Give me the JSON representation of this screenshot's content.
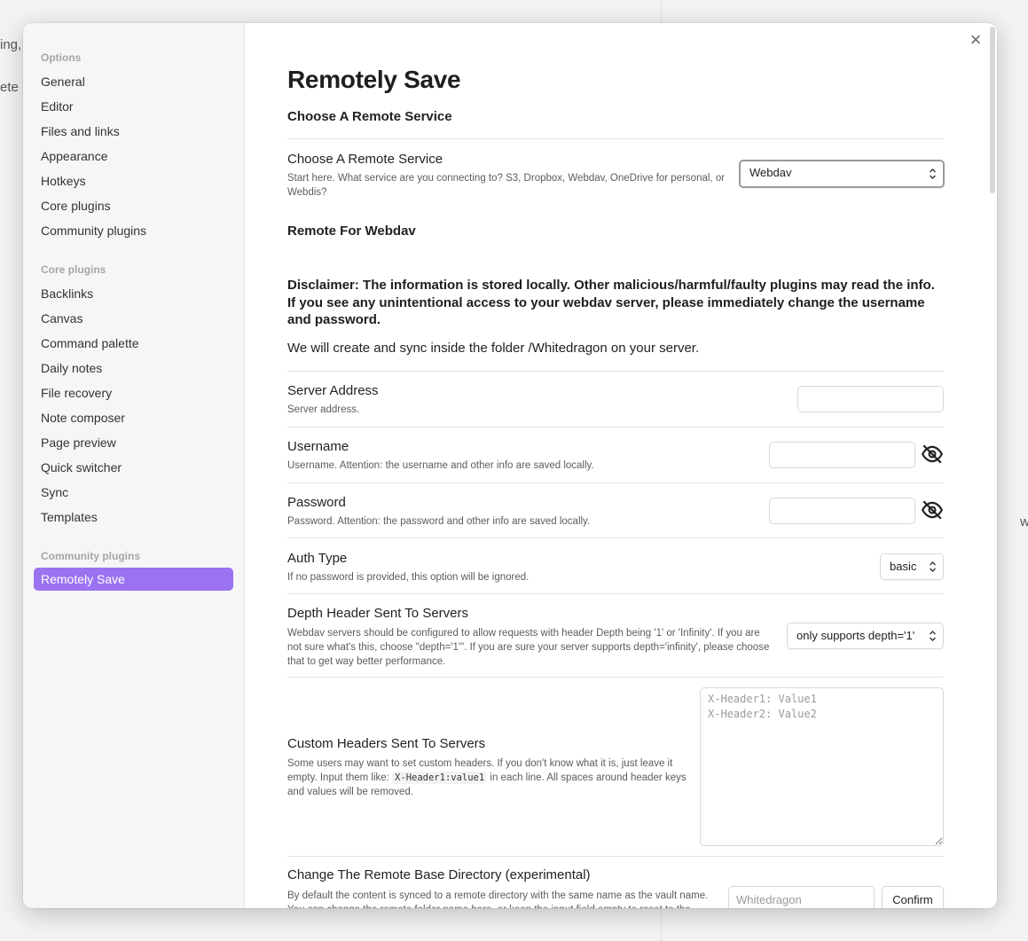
{
  "background": {
    "frag1": "ing,",
    "frag2": "ete",
    "frag3": "w"
  },
  "sidebar": {
    "groups": [
      {
        "heading": "Options",
        "items": [
          "General",
          "Editor",
          "Files and links",
          "Appearance",
          "Hotkeys",
          "Core plugins",
          "Community plugins"
        ]
      },
      {
        "heading": "Core plugins",
        "items": [
          "Backlinks",
          "Canvas",
          "Command palette",
          "Daily notes",
          "File recovery",
          "Note composer",
          "Page preview",
          "Quick switcher",
          "Sync",
          "Templates"
        ]
      },
      {
        "heading": "Community plugins",
        "items": [
          "Remotely Save"
        ]
      }
    ],
    "active_item": "Remotely Save"
  },
  "content": {
    "close_symbol": "×",
    "title": "Remotely Save",
    "section_choose": "Choose A Remote Service",
    "service": {
      "name": "Choose A Remote Service",
      "desc": "Start here. What service are you connecting to? S3, Dropbox, Webdav, OneDrive for personal, or Webdis?",
      "value": "Webdav"
    },
    "section_webdav": "Remote For Webdav",
    "disclaimer": "Disclaimer: The information is stored locally. Other malicious/harmful/faulty plugins may read the info. If you see any unintentional access to your webdav server, please immediately change the username and password.",
    "folder_note": "We will create and sync inside the folder /Whitedragon on your server.",
    "server_address": {
      "name": "Server Address",
      "desc": "Server address.",
      "value": ""
    },
    "username": {
      "name": "Username",
      "desc": "Username. Attention: the username and other info are saved locally.",
      "value": "",
      "toggle_icon": "eye-off-icon"
    },
    "password": {
      "name": "Password",
      "desc": "Password. Attention: the password and other info are saved locally.",
      "value": "",
      "toggle_icon": "eye-off-icon"
    },
    "auth_type": {
      "name": "Auth Type",
      "desc": "If no password is provided, this option will be ignored.",
      "value": "basic"
    },
    "depth": {
      "name": "Depth Header Sent To Servers",
      "desc": "Webdav servers should be configured to allow requests with header Depth being '1' or 'Infinity'. If you are not sure what's this, choose \"depth='1'\". If you are sure your server supports depth='infinity', please choose that to get way better performance.",
      "value": "only supports depth='1'"
    },
    "custom_headers": {
      "name": "Custom Headers Sent To Servers",
      "desc_pre": "Some users may want to set custom headers. If you don't know what it is, just leave it empty. Input them like: ",
      "desc_code": "X-Header1:value1",
      "desc_post": " in each line. All spaces around header keys and values will be removed.",
      "placeholder": "X-Header1: Value1\nX-Header2: Value2",
      "value": ""
    },
    "base_dir": {
      "name": "Change The Remote Base Directory (experimental)",
      "desc": "By default the content is synced to a remote directory with the same name as the vault name. You can change the remote folder name here, or keep the input field empty to reset to the default. You need to click \"Confirm\".",
      "placeholder": "Whitedragon",
      "confirm_label": "Confirm"
    }
  }
}
